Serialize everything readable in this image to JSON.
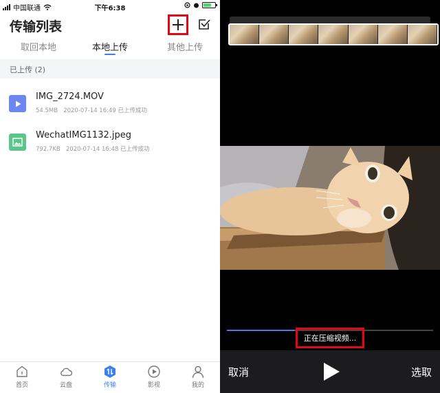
{
  "status_bar": {
    "carrier": "中国联通",
    "time": "下午6:38"
  },
  "header": {
    "title": "传输列表",
    "add_icon": "plus-icon",
    "select_icon": "checkbox-icon"
  },
  "tabs": [
    {
      "label": "取回本地",
      "active": false
    },
    {
      "label": "本地上传",
      "active": true
    },
    {
      "label": "其他上传",
      "active": false
    }
  ],
  "section": {
    "label": "已上传 (2)"
  },
  "files": [
    {
      "name": "IMG_2724.MOV",
      "size": "54.5MB",
      "date": "2020-07-14 16:49",
      "status": "已上传成功",
      "icon": "video-file-icon",
      "color": "#6e86f0"
    },
    {
      "name": "WechatIMG1132.jpeg",
      "size": "792.7KB",
      "date": "2020-07-14 16:48",
      "status": "已上传成功",
      "icon": "image-file-icon",
      "color": "#5bc68a"
    }
  ],
  "bottom_nav": [
    {
      "label": "首页",
      "icon": "home-icon",
      "active": false
    },
    {
      "label": "云盘",
      "icon": "cloud-icon",
      "active": false
    },
    {
      "label": "传输",
      "icon": "transfer-icon",
      "active": true
    },
    {
      "label": "影视",
      "icon": "play-circle-icon",
      "active": false
    },
    {
      "label": "我的",
      "icon": "person-icon",
      "active": false
    }
  ],
  "editor": {
    "compress_status": "正在压缩视频...",
    "progress": 0.33,
    "cancel_label": "取消",
    "select_label": "选取",
    "play_icon": "play-icon"
  },
  "colors": {
    "accent": "#3b7ff3",
    "highlight_box": "#e30613"
  }
}
